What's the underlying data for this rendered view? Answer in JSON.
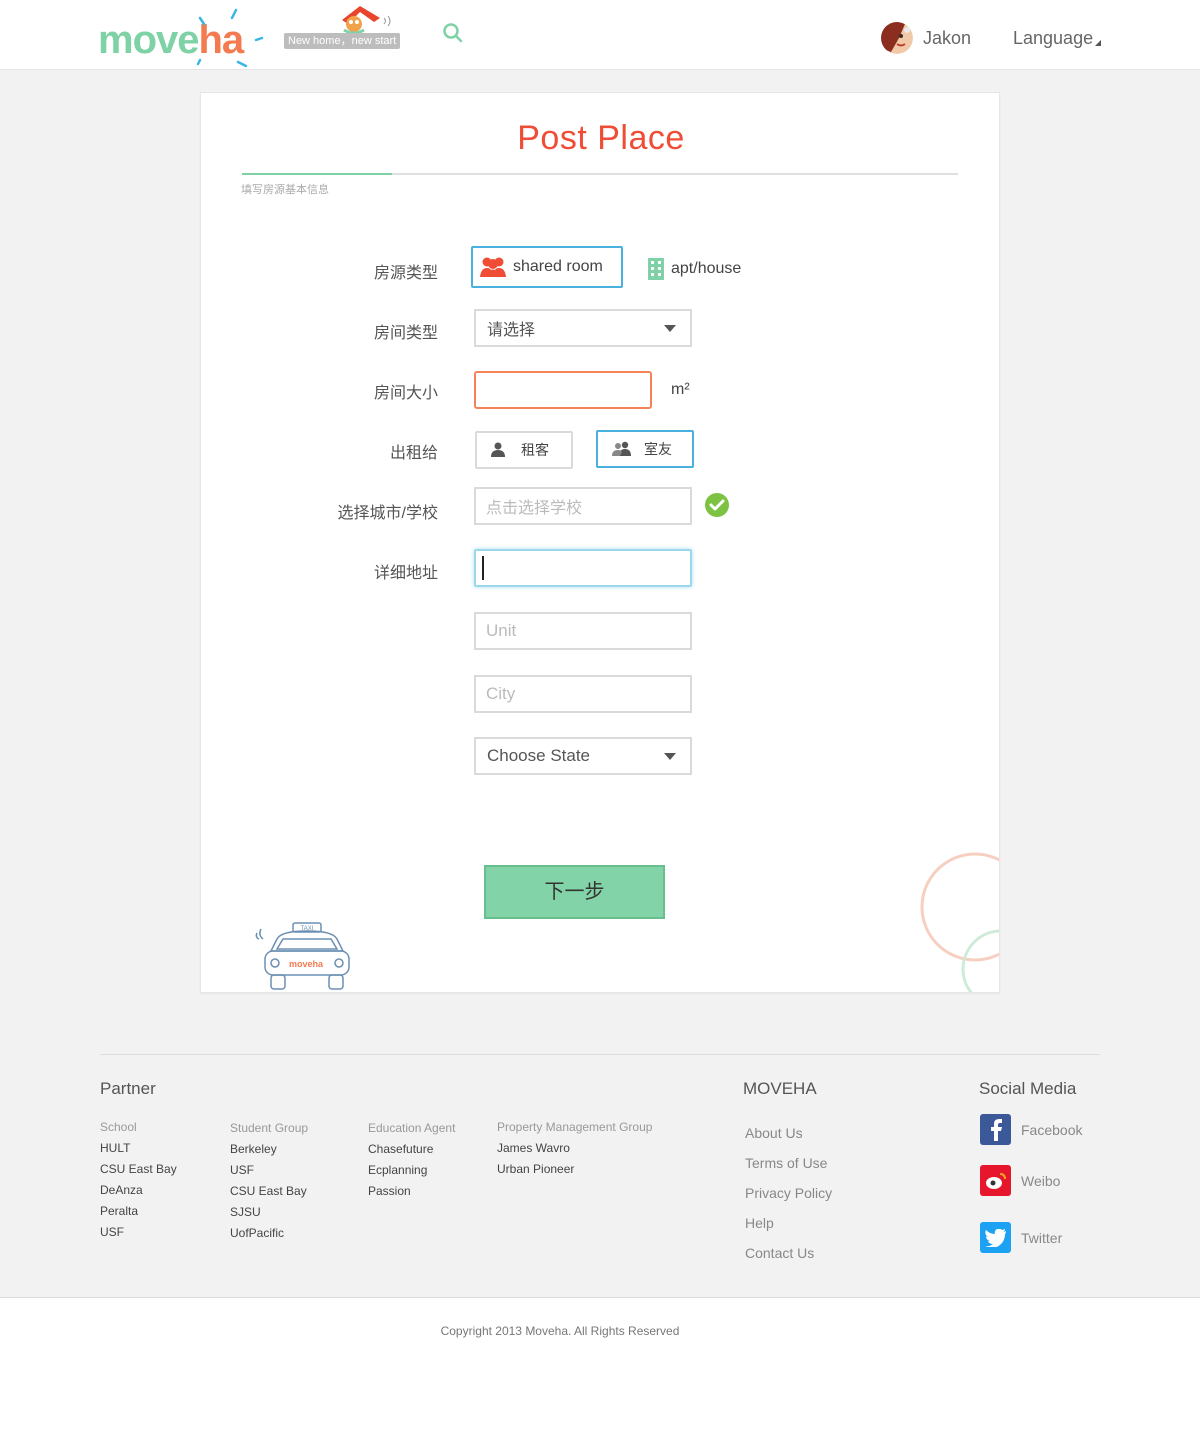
{
  "header": {
    "logo_move": "move",
    "logo_ha": "ha",
    "slogan": "New home，new start",
    "username": "Jakon",
    "language": "Language"
  },
  "form": {
    "title": "Post Place",
    "progress_fraction": 0.21,
    "step_label": "填写房源基本信息",
    "labels": {
      "listing_type": "房源类型",
      "room_type": "房间类型",
      "room_size": "房间大小",
      "rent_to": "出租给",
      "city_school": "选择城市/学校",
      "address": "详细地址"
    },
    "listing_types": [
      {
        "label": "shared room",
        "selected": true
      },
      {
        "label": "apt/house",
        "selected": false
      }
    ],
    "room_type_value": "请选择",
    "room_size_value": "",
    "room_size_unit": "m²",
    "rent_to": [
      {
        "label": "租客",
        "selected": false
      },
      {
        "label": "室友",
        "selected": true
      }
    ],
    "school_placeholder": "点击选择学校",
    "address_value": "",
    "unit_placeholder": "Unit",
    "city_placeholder": "City",
    "state_value": "Choose State",
    "next_label": "下一步"
  },
  "footer": {
    "partner_heading": "Partner",
    "partner_columns": [
      {
        "heading": "School",
        "items": [
          "HULT",
          "CSU East Bay",
          "DeAnza",
          "Peralta",
          "USF"
        ]
      },
      {
        "heading": "Student Group",
        "items": [
          "Berkeley",
          "USF",
          "CSU East Bay",
          "SJSU",
          "UofPacific"
        ]
      },
      {
        "heading": "Education Agent",
        "items": [
          "Chasefuture",
          "Ecplanning",
          "Passion"
        ]
      },
      {
        "heading": "Property Management Group",
        "items": [
          "James Wavro",
          "Urban Pioneer"
        ]
      }
    ],
    "moveha_heading": "MOVEHA",
    "moveha_links": [
      "About Us",
      "Terms of Use",
      "Privacy Policy",
      "Help",
      "Contact Us"
    ],
    "social_heading": "Social Media",
    "social": [
      {
        "label": "Facebook",
        "icon": "facebook-icon",
        "color": "#3b5998"
      },
      {
        "label": "Weibo",
        "icon": "weibo-icon",
        "color": "#e6162d"
      },
      {
        "label": "Twitter",
        "icon": "twitter-icon",
        "color": "#1da1f2"
      }
    ],
    "copyright": "Copyright 2013 Moveha.  All Rights Reserved"
  },
  "colors": {
    "brand_green": "#7fd2a6",
    "brand_orange": "#f47a4f",
    "title_red": "#ef4d36",
    "selected_blue": "#49b0e0"
  }
}
